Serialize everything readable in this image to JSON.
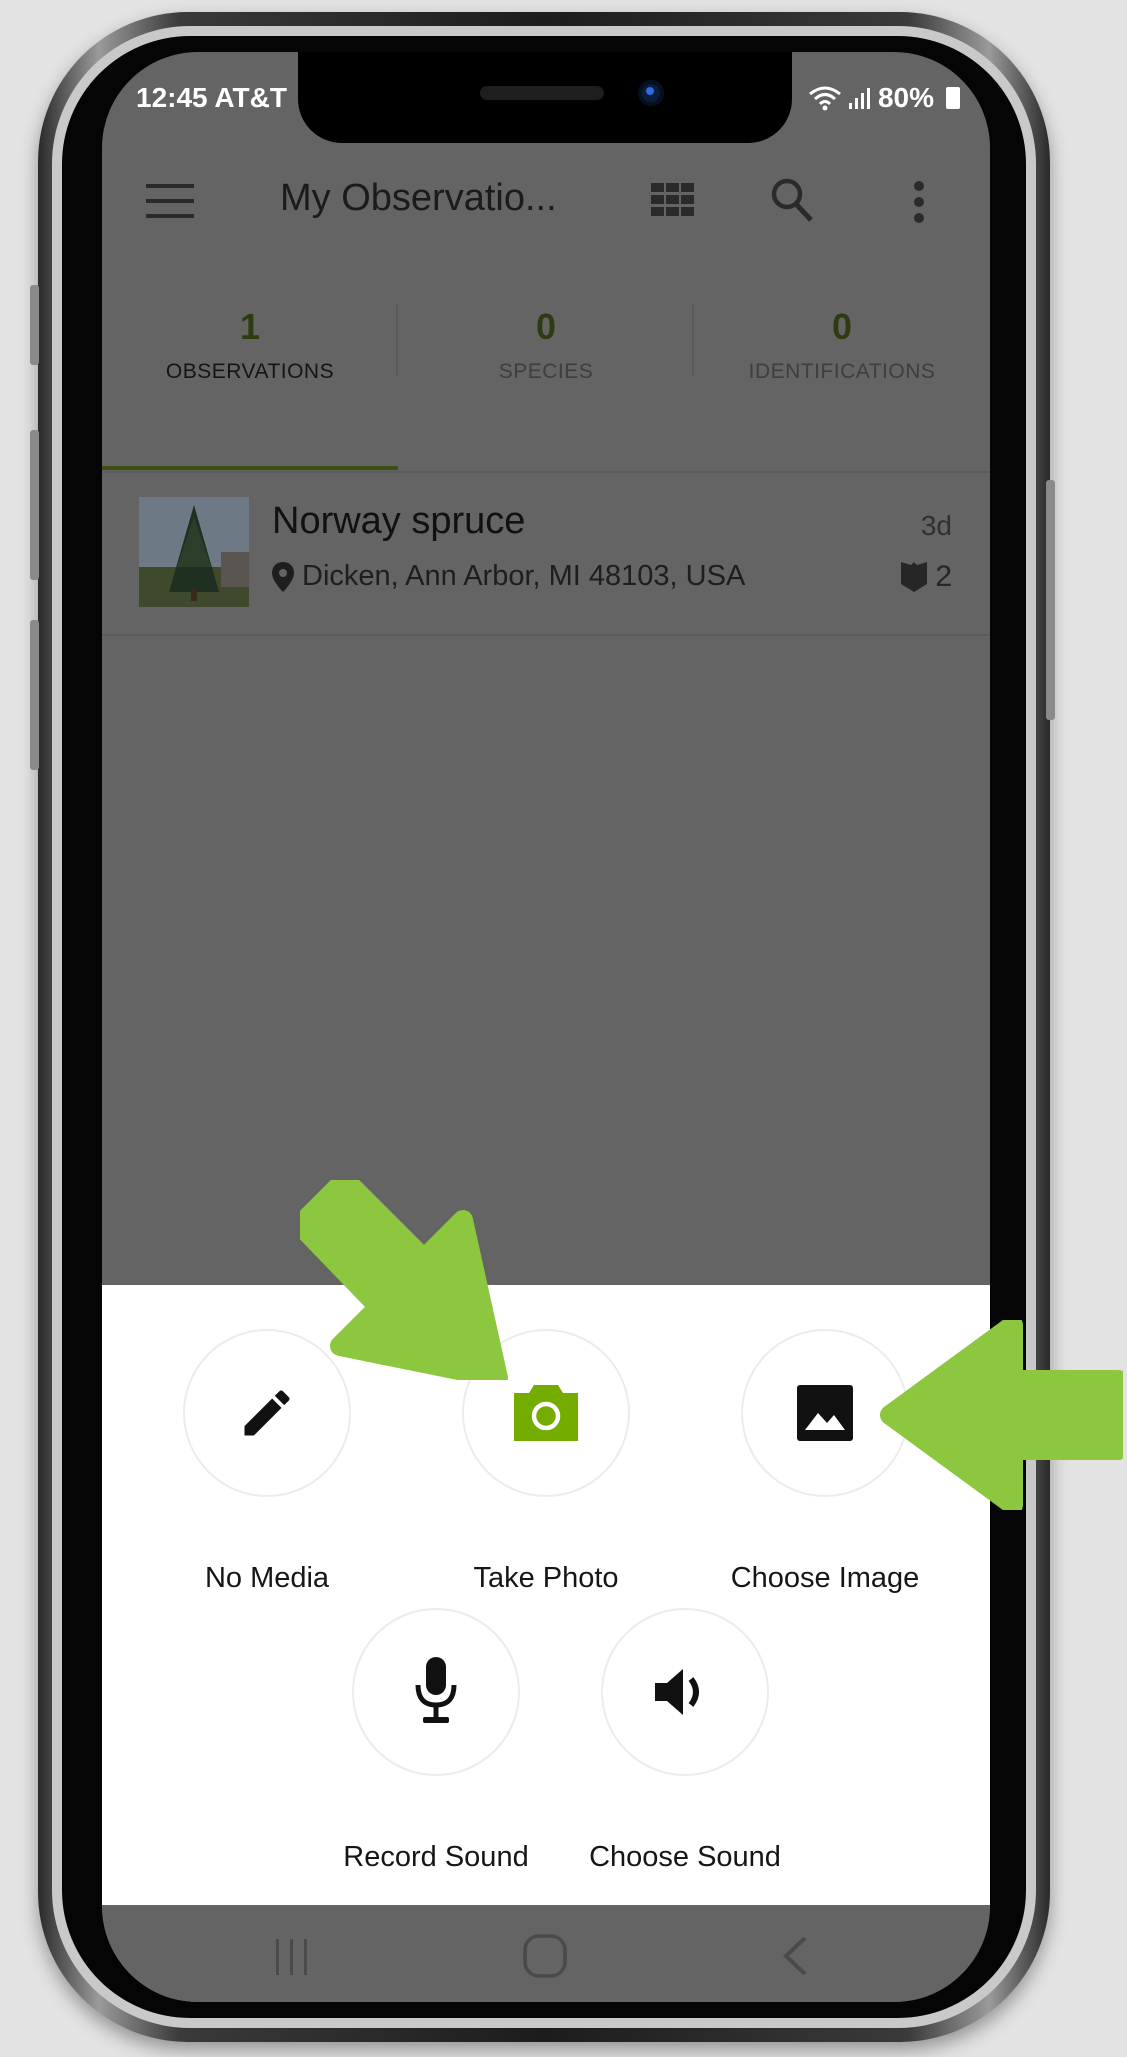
{
  "status_bar": {
    "time": "12:45 AT&T",
    "battery": "80%"
  },
  "toolbar": {
    "title": "My Observatio..."
  },
  "tabs": [
    {
      "count": "1",
      "label": "OBSERVATIONS",
      "active": true
    },
    {
      "count": "0",
      "label": "SPECIES",
      "active": false
    },
    {
      "count": "0",
      "label": "IDENTIFICATIONS",
      "active": false
    }
  ],
  "observation": {
    "name": "Norway spruce",
    "place": "Dicken, Ann Arbor, MI 48103, USA",
    "age": "3d",
    "id_count": "2"
  },
  "media_options": [
    {
      "label": "No Media",
      "icon": "pencil-icon"
    },
    {
      "label": "Take Photo",
      "icon": "camera-icon"
    },
    {
      "label": "Choose Image",
      "icon": "image-icon"
    },
    {
      "label": "Record Sound",
      "icon": "microphone-icon"
    },
    {
      "label": "Choose Sound",
      "icon": "speaker-icon"
    }
  ],
  "colors": {
    "accent": "#74ac00",
    "annotation_arrow": "#8dc63f",
    "dim_overlay": "#646464"
  }
}
